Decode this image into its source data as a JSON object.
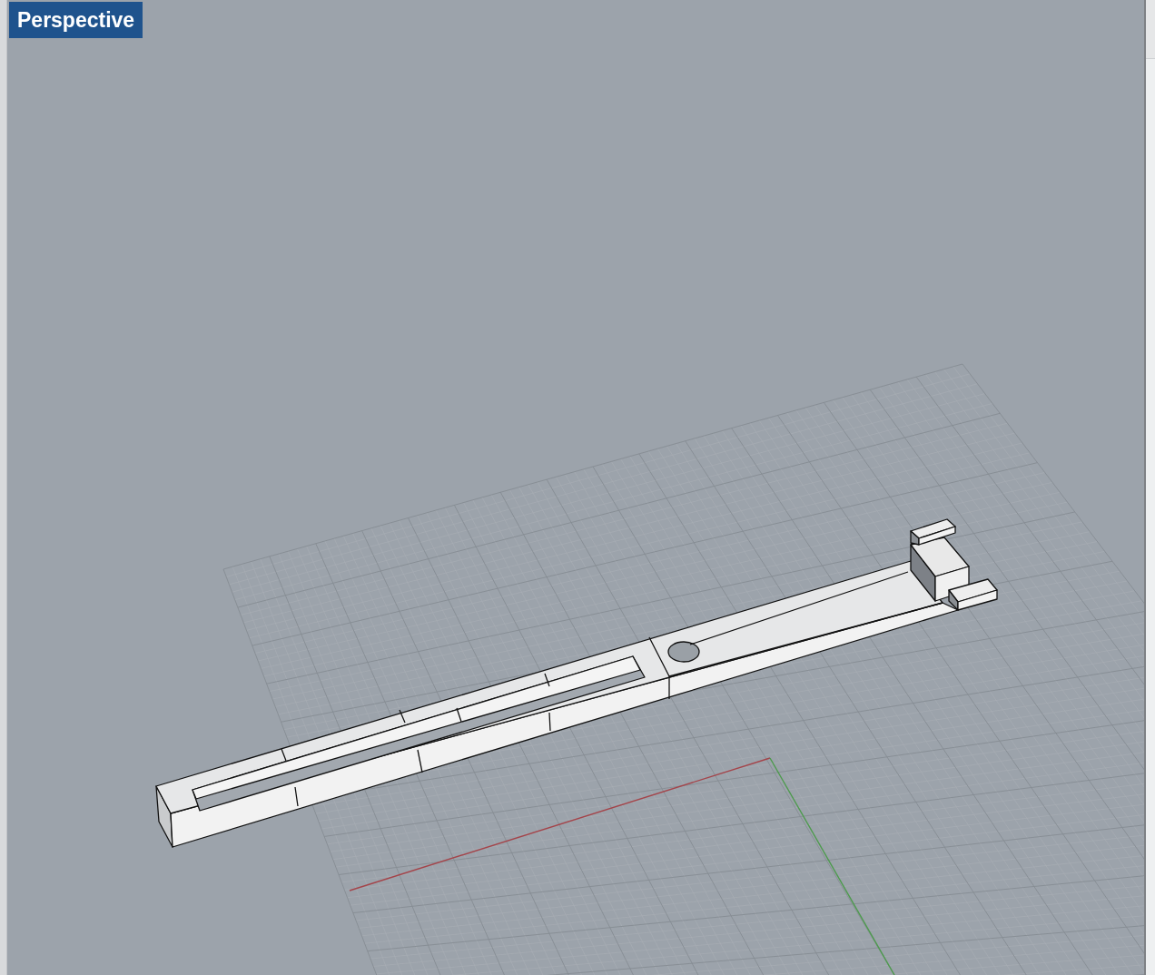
{
  "viewport": {
    "title": "Perspective"
  }
}
